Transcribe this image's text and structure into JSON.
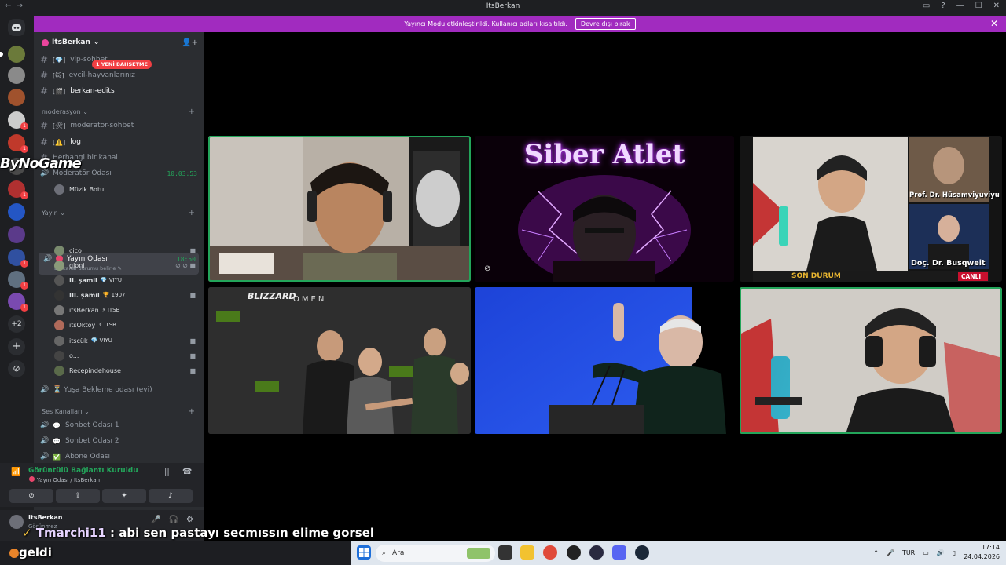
{
  "window": {
    "title": "ItsBerkan",
    "back_glyph": "←",
    "forward_glyph": "→"
  },
  "banner": {
    "text": "Yayıncı Modu etkinleştirildi. Kullanıcı adları kısaltıldı.",
    "button": "Devre dışı bırak",
    "close": "✕"
  },
  "server_rail": {
    "more_label": "+2"
  },
  "sidebar": {
    "server_name": "ItsBerkan",
    "mention_pill": "1 YENİ BAHSETME",
    "top_channels": [
      {
        "emoji": "💎",
        "name": "vip-sohbet"
      },
      {
        "emoji": "🐱",
        "name": "evcil-hayvanlarınız"
      },
      {
        "emoji": "🎬",
        "name": "berkan-edits"
      }
    ],
    "categories": {
      "moderation": "moderasyon",
      "yayin": "Yayın",
      "ses": "Ses Kanalları"
    },
    "mod_channels": [
      {
        "emoji": "🛠",
        "name": "moderator-sohbet"
      },
      {
        "emoji": "⚠️",
        "name": "log"
      },
      {
        "emoji": "",
        "name": "Herhangi bir kanal"
      }
    ],
    "mod_voice": {
      "name": "Moderatör Odası",
      "time": "10:03:53",
      "bot": "Müzik Botu"
    },
    "stream_room": {
      "name": "Yayın Odası",
      "time": "18:50",
      "status": "Bir kanal durumu belirle ✎"
    },
    "users": [
      {
        "name": "cico",
        "tag": "",
        "color": "#7a8b6e"
      },
      {
        "name": "gloni",
        "tag": "",
        "color": "#8a9a7a"
      },
      {
        "name": "II. şamil",
        "tag": "💎 VIYU",
        "color": "#555"
      },
      {
        "name": "III. şamil",
        "tag": "🏆 1907",
        "color": "#333"
      },
      {
        "name": "itsBerkan",
        "tag": "⚡ ITSB",
        "color": "#777"
      },
      {
        "name": "itsOktoy",
        "tag": "⚡ ITSB",
        "color": "#b06a5a"
      },
      {
        "name": "itsçük",
        "tag": "💎 VIYU",
        "color": "#666"
      },
      {
        "name": "o...",
        "tag": "",
        "color": "#444"
      },
      {
        "name": "Recepindehouse",
        "tag": "",
        "color": "#5a6a4a"
      }
    ],
    "afk_room": "⏳ Yuşa Bekleme odası (evi)",
    "voice_channels": [
      "Sohbet Odası 1",
      "Sohbet Odası 2",
      "Abone Odası"
    ]
  },
  "voice_panel": {
    "status": "Görüntülü Bağlantı Kuruldu",
    "sub": "Yayın Odası / ItsBerkan"
  },
  "user_panel": {
    "name": "ItsBerkan",
    "status": "Görünmez"
  },
  "stage": {
    "siber_title": "Siber Atlet",
    "news_name_1": "Prof. Dr. Hüsamviyuviyu",
    "news_name_2": "Doç. Dr. Busqweit",
    "news_ticker": "SON DURUM",
    "live_badge": "CANLI",
    "banner_left": "BLIZZARD",
    "banner_omen": "OMEN"
  },
  "overlay": {
    "bynogame": "ByNoGame",
    "chat_nick": "Tmarchi11",
    "chat_msg": " : abi sen pastayı secmıssın elime gorsel",
    "geldi": "geldi"
  },
  "taskbar": {
    "search_placeholder": "Ara",
    "lang": "TUR",
    "time": "17:14",
    "date": "24.04.2026"
  }
}
